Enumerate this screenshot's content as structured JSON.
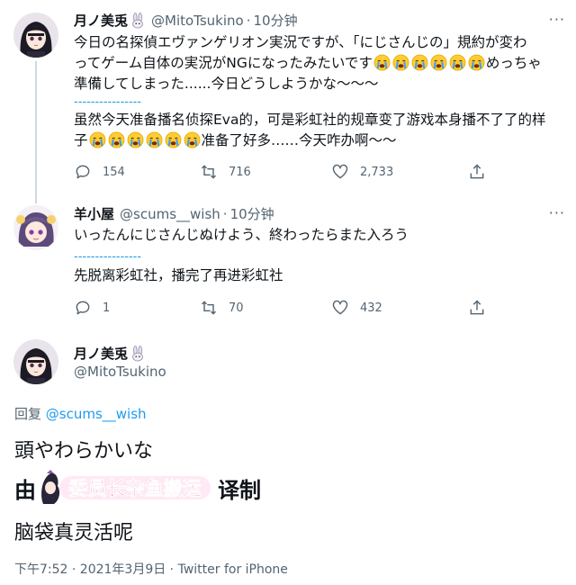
{
  "tweet1": {
    "name": "月ノ美兎",
    "handle": "@MitoTsukino",
    "dot": "·",
    "time": "10分钟",
    "more": "···",
    "jp_line1": "今日の名探偵エヴァンゲリオン実況ですが、「にじさんじの」規約が変わ",
    "jp_line2a": "ってゲーム自体の実況がNGになったみたいです",
    "jp_line2b": "めっちゃ",
    "jp_line3": "準備してしまった......今日どうしようかな〜〜〜",
    "separator": "----------------",
    "cn_line1": "虽然今天准备播名侦探Eva的，可是彩虹社的规章变了游戏本身播不了了的样",
    "cn_line2a": "子",
    "cn_line2b": "准备了好多……今天咋办啊〜〜",
    "replies": "154",
    "retweets": "716",
    "likes": "2,733"
  },
  "tweet2": {
    "name": "羊小屋",
    "handle": "@scums__wish",
    "dot": "·",
    "time": "10分钟",
    "more": "···",
    "jp_line": "いったんにじさんじぬけよう、終わったらまた入ろう",
    "separator": "----------------",
    "cn_line": "先脱离彩虹社，播完了再进彩虹社",
    "replies": "1",
    "retweets": "70",
    "likes": "432"
  },
  "tweet3": {
    "name": "月ノ美兎",
    "handle": "@MitoTsukino",
    "reply_prefix": "回复",
    "reply_mention": "@scums__wish",
    "jp_text": "頭やわらかいな",
    "watermark_pre": "由",
    "watermark_logo": "委员长杂鱼搬运",
    "watermark_post": "译制",
    "cn_text": "脑袋真灵活呢",
    "meta": "下午7:52 · 2021年3月9日 · Twitter for iPhone"
  },
  "colors": {
    "text": "#0f1419",
    "secondary": "#536471",
    "link": "#1d9bf0",
    "thread_line": "#cfd9de",
    "watermark_pink": "#e0408a"
  }
}
